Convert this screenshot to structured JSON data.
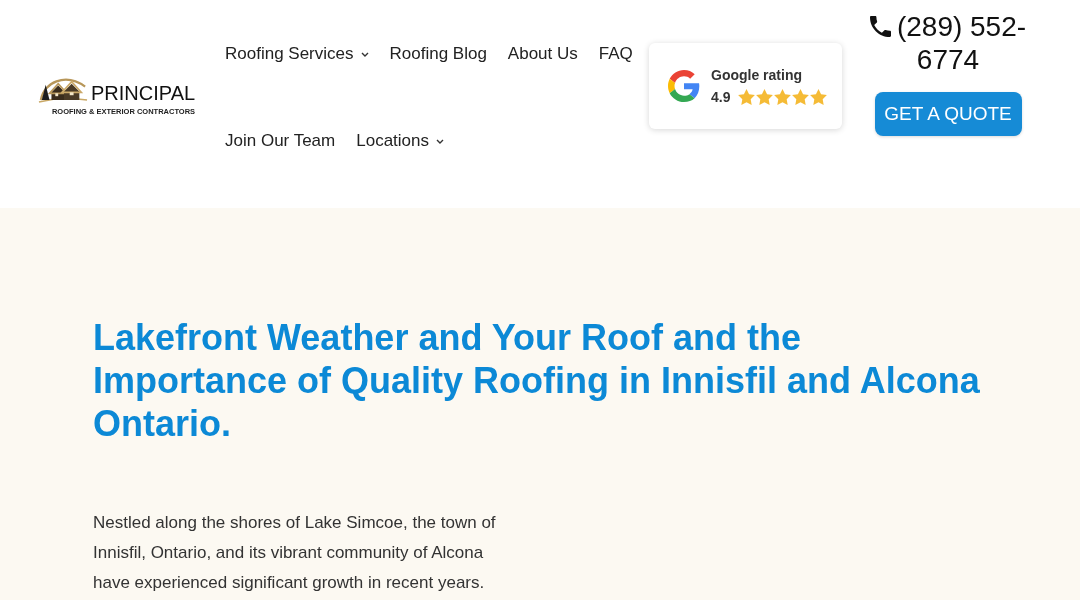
{
  "header": {
    "logo": {
      "wordmark": "PRINCIPAL",
      "tagline": "ROOFING & EXTERIOR CONTRACTORS"
    },
    "nav": [
      {
        "label": "Roofing Services",
        "dropdown": true
      },
      {
        "label": "Roofing Blog",
        "dropdown": false
      },
      {
        "label": "About Us",
        "dropdown": false
      },
      {
        "label": "FAQ",
        "dropdown": false
      },
      {
        "label": "Join Our Team",
        "dropdown": false
      },
      {
        "label": "Locations",
        "dropdown": true
      }
    ],
    "rating_badge": {
      "title": "Google rating",
      "score": "4.9",
      "stars": 5
    },
    "phone": "(289) 552-6774",
    "cta": "GET A QUOTE"
  },
  "article": {
    "title": "Lakefront Weather and Your Roof and the Importance of Quality Roofing in Innisfil and Alcona Ontario.",
    "paragraph": "Nestled along the shores of Lake Simcoe, the town of Innisfil, Ontario, and its vibrant community of Alcona have experienced significant growth in recent years."
  }
}
